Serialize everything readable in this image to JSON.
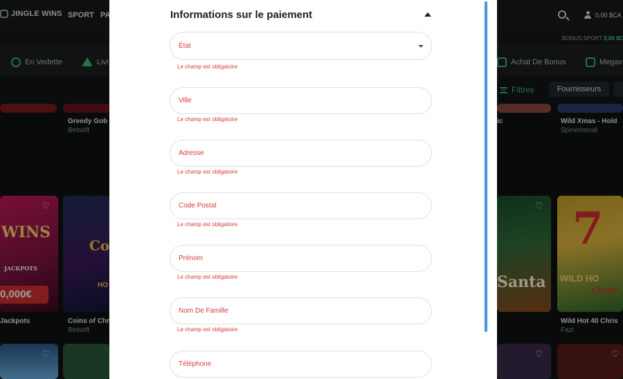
{
  "header": {
    "brand": "JINGLE WINS",
    "nav": [
      "SPORT",
      "PA"
    ],
    "balance": "0,00 $CA"
  },
  "bonus_strip": {
    "label": "BONUS SPORT",
    "value": "0,00 $C"
  },
  "categories": [
    "En Vedette",
    "Livi",
    "Achat De Bonus",
    "Megav"
  ],
  "filters": {
    "filtres_label": "Filtres",
    "fournisseurs_label": "Fournisseurs"
  },
  "games": [
    {
      "name": "Greedy Gob",
      "provider": "Betsoft"
    },
    {
      "name": "ic",
      "provider": ""
    },
    {
      "name": "Wild Xmas - Hold",
      "provider": "Spinomenal"
    },
    {
      "name": "Jackpots",
      "provider": ""
    },
    {
      "name": "Coins of Chr",
      "provider": "Betsoft"
    },
    {
      "name": "Wild Hot 40 Chris",
      "provider": "Fazi"
    }
  ],
  "tile_art": {
    "wins_tile": {
      "big": "WINS",
      "sub": "JACKPOTS",
      "prize": "0,000€"
    },
    "coins_tile": {
      "big": "Co",
      "sub": "HO"
    },
    "santa_tile": {
      "big": "Santa"
    },
    "wildhot_tile": {
      "big": "WILD HO",
      "sub": "Christ"
    }
  },
  "modal": {
    "title": "Informations sur le paiement",
    "fields": [
      {
        "label": "État",
        "error": "Le champ est obligatoire"
      },
      {
        "label": "Ville",
        "error": "Le champ est obligatoire"
      },
      {
        "label": "Adresse",
        "error": "Le champ est obligatoire"
      },
      {
        "label": "Code Postal",
        "error": "Le champ est obligatoire"
      },
      {
        "label": "Prénom",
        "error": "Le champ est obligatoire"
      },
      {
        "label": "Nom De Famille",
        "error": "Le champ est obligatoire"
      },
      {
        "label": "Téléphone"
      }
    ]
  },
  "colors": {
    "accent_green": "#3fb86a",
    "error_red": "#d63b3b",
    "scrollbar_blue": "#4a98e0"
  }
}
